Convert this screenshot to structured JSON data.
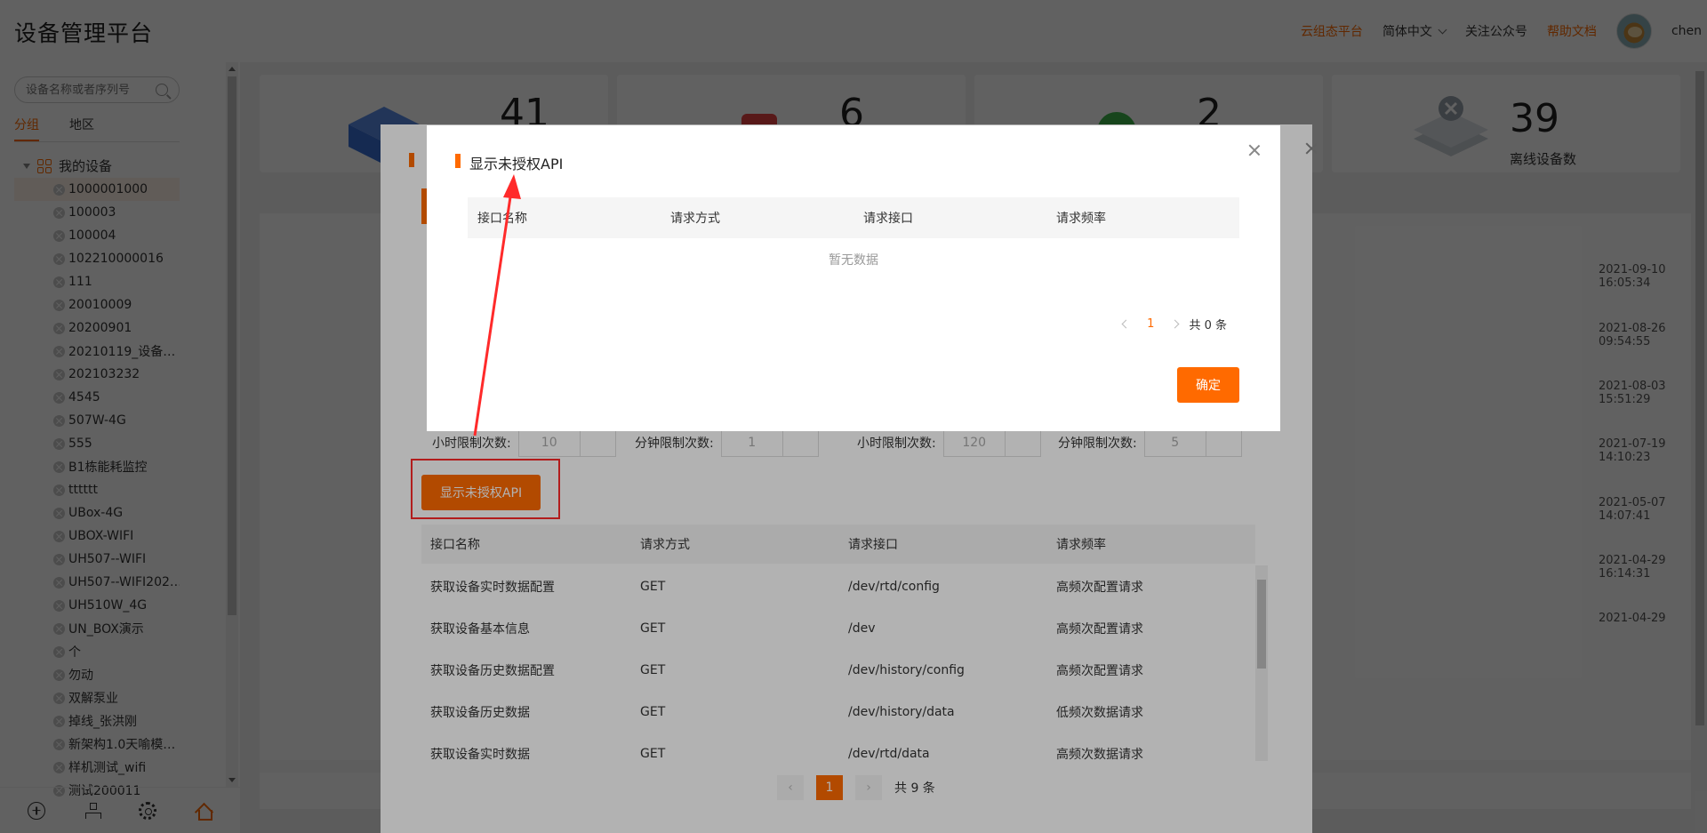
{
  "header": {
    "brand": "设备管理平台",
    "links": {
      "cloud": "云组态平台",
      "lang": "简体中文",
      "follow": "关注公众号",
      "help": "帮助文档",
      "user": "chen"
    }
  },
  "sidebar": {
    "search_placeholder": "设备名称或者序列号",
    "tabs": [
      "分组",
      "地区"
    ],
    "root": "我的设备",
    "devices": [
      "1000001000",
      "100003",
      "100004",
      "102210000016",
      "111",
      "20010009",
      "20200901",
      "20210119_设备…",
      "202103232",
      "4545",
      "507W-4G",
      "555",
      "B1栋能耗监控",
      "tttttt",
      "UBox-4G",
      "UBOX-WIFI",
      "UH507--WIFI",
      "UH507--WIFI202…",
      "UH510W_4G",
      "UN_BOX演示",
      "个",
      "勿动",
      "双解泵业",
      "掉线_张洪刚",
      "新架构1.0天喻模…",
      "样机测试_wifi",
      "测试200011"
    ]
  },
  "stats": [
    {
      "value": "41",
      "label": ""
    },
    {
      "value": "6",
      "label": ""
    },
    {
      "value": "2",
      "label": ""
    },
    {
      "value": "39",
      "label": "离线设备数"
    }
  ],
  "times": [
    [
      "2021-09-10",
      "16:05:34"
    ],
    [
      "2021-08-26",
      "09:54:55"
    ],
    [
      "2021-08-03",
      "15:51:29"
    ],
    [
      "2021-07-19",
      "14:10:23"
    ],
    [
      "2021-05-07",
      "14:07:41"
    ],
    [
      "2021-04-29",
      "16:14:31"
    ],
    [
      "2021-04-29",
      ""
    ]
  ],
  "dialog2": {
    "limits": [
      {
        "label": "小时限制次数:",
        "value": "10"
      },
      {
        "label": "分钟限制次数:",
        "value": "1"
      },
      {
        "label": "小时限制次数:",
        "value": "120"
      },
      {
        "label": "分钟限制次数:",
        "value": "5"
      }
    ],
    "show_button": "显示未授权API",
    "columns": [
      "接口名称",
      "请求方式",
      "请求接口",
      "请求频率"
    ],
    "rows": [
      [
        "获取设备实时数据配置",
        "GET",
        "/dev/rtd/config",
        "高频次配置请求"
      ],
      [
        "获取设备基本信息",
        "GET",
        "/dev",
        "高频次配置请求"
      ],
      [
        "获取设备历史数据配置",
        "GET",
        "/dev/history/config",
        "高频次配置请求"
      ],
      [
        "获取设备历史数据",
        "GET",
        "/dev/history/data",
        "低频次数据请求"
      ],
      [
        "获取设备实时数据",
        "GET",
        "/dev/rtd/data",
        "高频次数据请求"
      ]
    ],
    "pager": {
      "page": "1",
      "total": "共 9 条"
    }
  },
  "dialog1": {
    "title": "显示未授权API",
    "columns": [
      "接口名称",
      "请求方式",
      "请求接口",
      "请求频率"
    ],
    "empty": "暂无数据",
    "pager": {
      "page": "1",
      "total": "共 0 条"
    },
    "confirm": "确定"
  },
  "colors": {
    "accent": "#ff6a00",
    "annotation": "#ff2a2a"
  }
}
